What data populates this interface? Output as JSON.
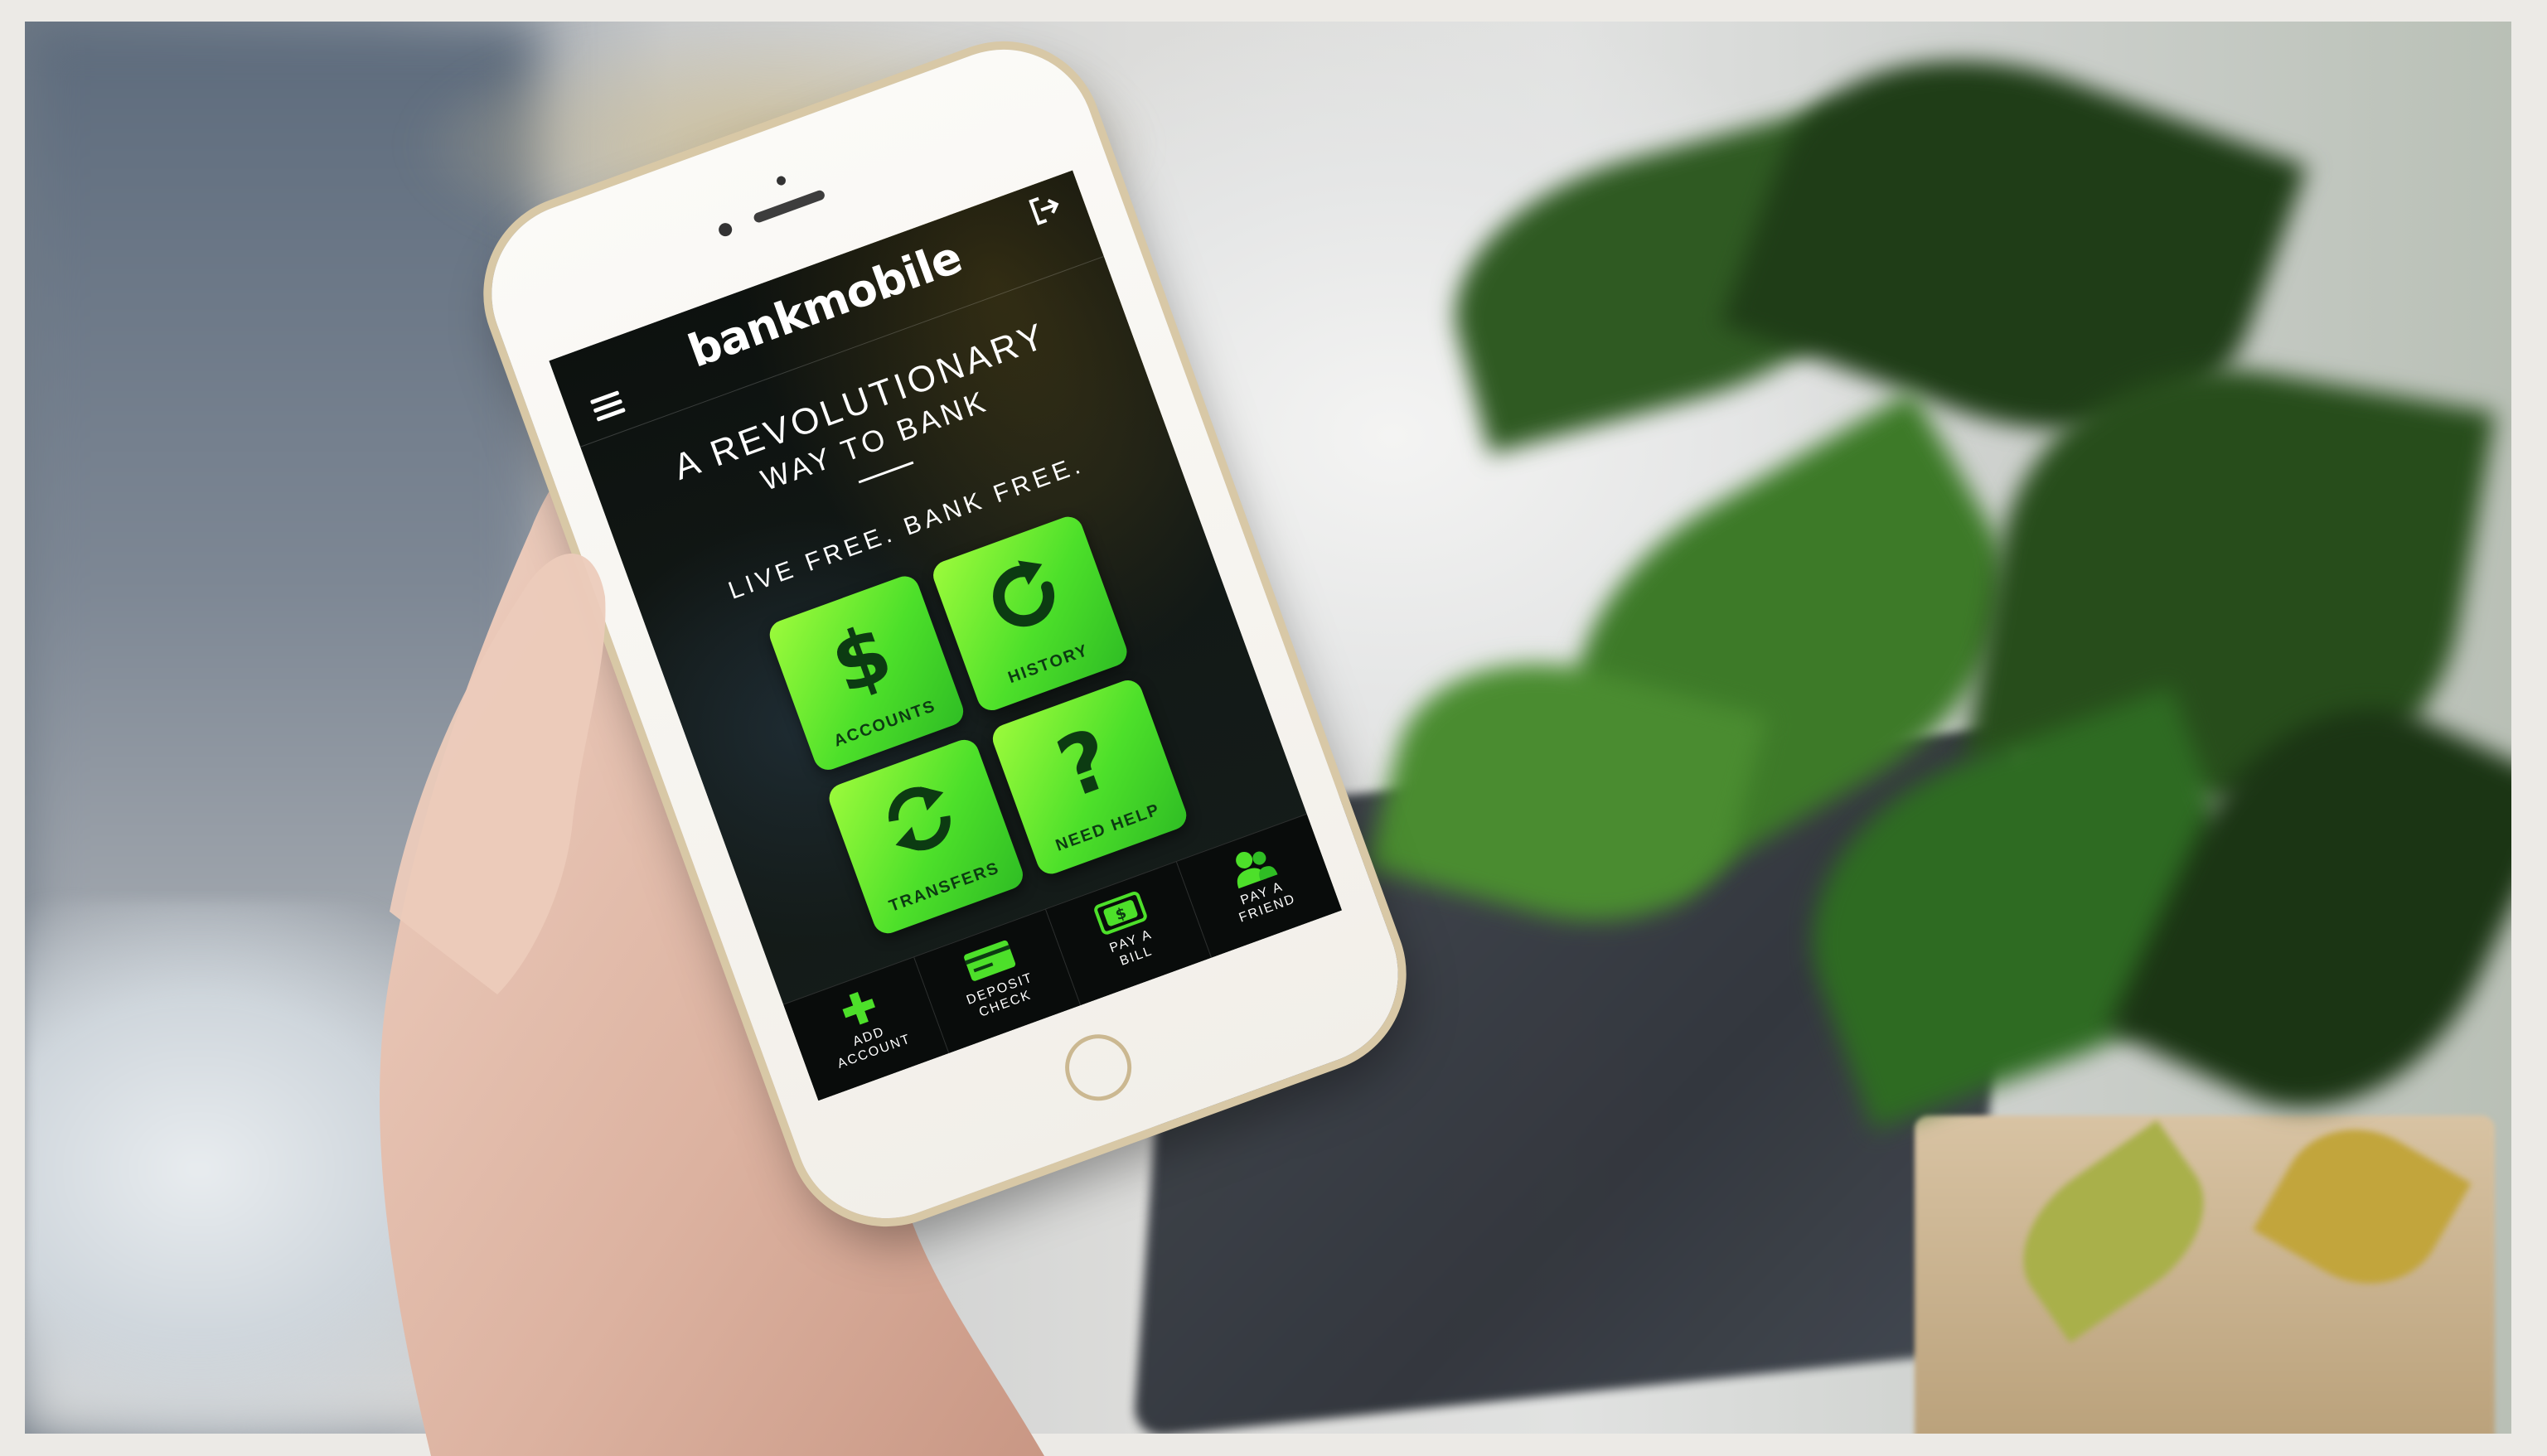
{
  "app": {
    "logo_text": "bankmobile",
    "headline_line1": "A REVOLUTIONARY",
    "headline_line2": "WAY TO BANK",
    "tagline": "LIVE FREE. BANK FREE."
  },
  "icons": {
    "menu": "menu-icon",
    "logout": "logout-icon",
    "accounts": "dollar-icon",
    "history": "refresh-icon",
    "transfers": "swap-icon",
    "help": "question-icon",
    "add_account": "plus-icon",
    "deposit_check": "check-icon",
    "pay_bill": "bill-icon",
    "pay_friend": "people-icon"
  },
  "tiles": [
    {
      "label": "ACCOUNTS"
    },
    {
      "label": "HISTORY"
    },
    {
      "label": "TRANSFERS"
    },
    {
      "label": "NEED HELP"
    }
  ],
  "bottom_nav": [
    {
      "label": "ADD\nACCOUNT"
    },
    {
      "label": "DEPOSIT\nCHECK"
    },
    {
      "label": "PAY A\nBILL"
    },
    {
      "label": "PAY A\nFRIEND"
    }
  ],
  "colors": {
    "accent_green": "#4de02a",
    "accent_green_light": "#9dfb3c",
    "icon_dark_green": "#0c3b12",
    "screen_dark": "#1a201c"
  }
}
